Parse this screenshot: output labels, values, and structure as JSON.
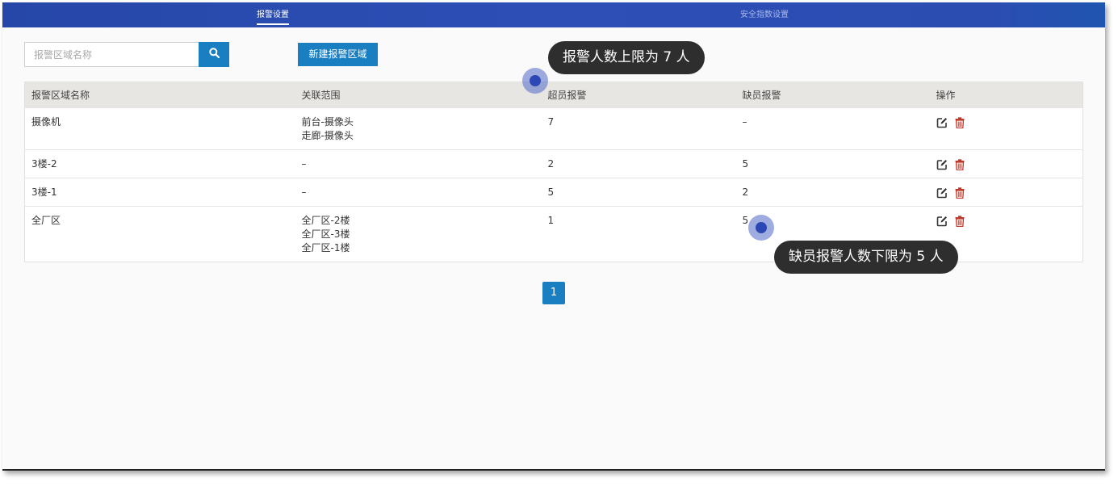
{
  "tabs": [
    {
      "label": "报警设置",
      "active": true
    },
    {
      "label": "安全指数设置",
      "active": false
    }
  ],
  "search": {
    "placeholder": "报警区域名称",
    "value": ""
  },
  "new_button_label": "新建报警区域",
  "table": {
    "headers": [
      "报警区域名称",
      "关联范围",
      "超员报警",
      "缺员报警",
      "操作"
    ],
    "rows": [
      {
        "name": "摄像机",
        "scope": [
          "前台-摄像头",
          "走廊-摄像头"
        ],
        "over": "7",
        "under": "–"
      },
      {
        "name": "3楼-2",
        "scope": [
          "–"
        ],
        "over": "2",
        "under": "5"
      },
      {
        "name": "3楼-1",
        "scope": [
          "–"
        ],
        "over": "5",
        "under": "2"
      },
      {
        "name": "全厂区",
        "scope": [
          "全厂区-2楼",
          "全厂区-3楼",
          "全厂区-1楼"
        ],
        "over": "1",
        "under": "5"
      }
    ]
  },
  "pagination": {
    "current": "1"
  },
  "tooltips": {
    "over_limit": "报警人数上限为 7 人",
    "under_limit": "缺员报警人数下限为 5 人"
  },
  "colors": {
    "topbar": "#2d4fb6",
    "accent": "#1a7fc1",
    "edit_icon": "#333333",
    "delete_icon": "#c0392b"
  },
  "icons": {
    "search": "search-icon",
    "edit": "edit-icon",
    "delete": "trash-icon"
  }
}
